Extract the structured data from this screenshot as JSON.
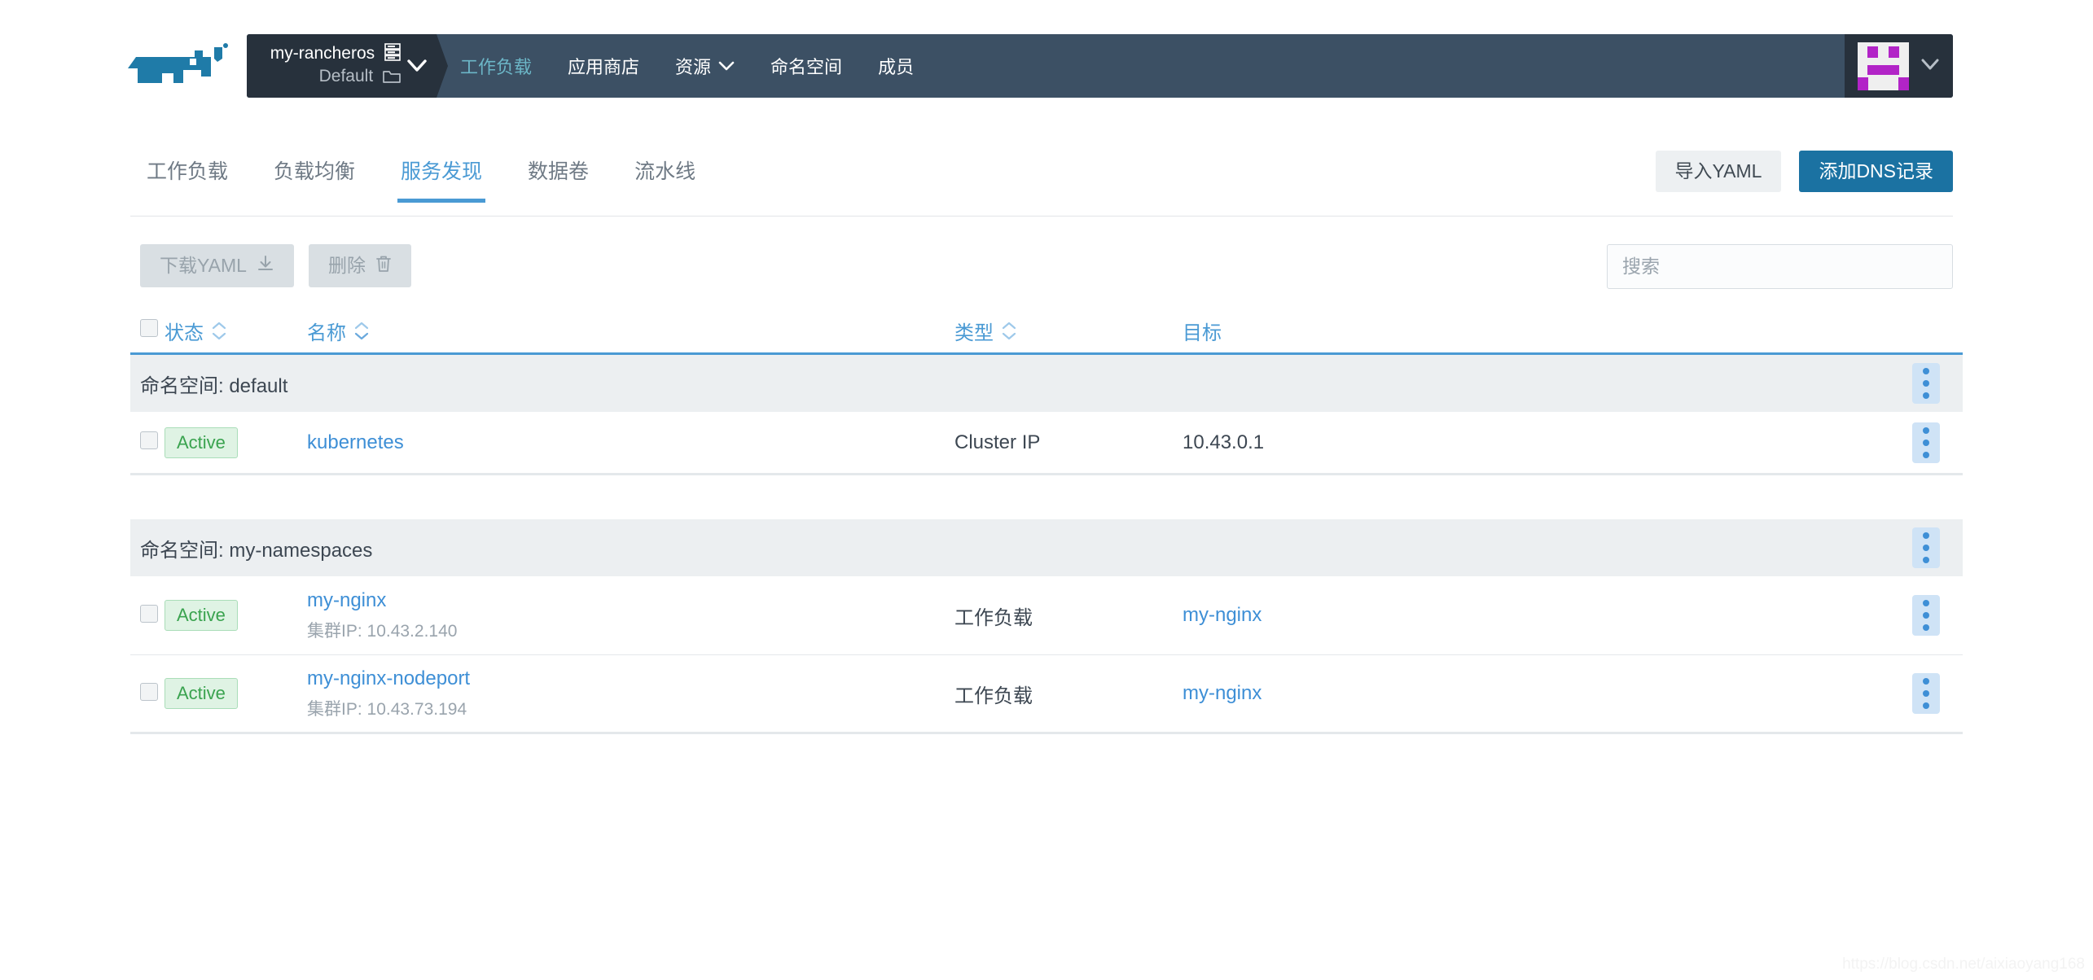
{
  "header": {
    "logo_name": "rancher-logo",
    "cluster": {
      "cluster_name": "my-rancheros",
      "project_name": "Default"
    },
    "nav": [
      {
        "label": "工作负载",
        "active": true,
        "has_chevron": false
      },
      {
        "label": "应用商店",
        "active": false,
        "has_chevron": false
      },
      {
        "label": "资源",
        "active": false,
        "has_chevron": true
      },
      {
        "label": "命名空间",
        "active": false,
        "has_chevron": false
      },
      {
        "label": "成员",
        "active": false,
        "has_chevron": false
      }
    ]
  },
  "tabs": [
    {
      "label": "工作负载",
      "active": false
    },
    {
      "label": "负载均衡",
      "active": false
    },
    {
      "label": "服务发现",
      "active": true
    },
    {
      "label": "数据卷",
      "active": false
    },
    {
      "label": "流水线",
      "active": false
    }
  ],
  "header_actions": {
    "import_yaml": "导入YAML",
    "add_dns": "添加DNS记录"
  },
  "toolbar": {
    "download_yaml": "下载YAML",
    "delete": "删除"
  },
  "search": {
    "value": "",
    "placeholder": "搜索"
  },
  "table": {
    "columns": {
      "state": "状态",
      "name": "名称",
      "type": "类型",
      "target": "目标"
    },
    "groups": [
      {
        "label": "命名空间: default",
        "rows": [
          {
            "state": "Active",
            "name": "kubernetes",
            "subtitle": "",
            "type": "Cluster IP",
            "target": "10.43.0.1",
            "target_is_link": false
          }
        ]
      },
      {
        "label": "命名空间: my-namespaces",
        "rows": [
          {
            "state": "Active",
            "name": "my-nginx",
            "subtitle": "集群IP: 10.43.2.140",
            "type": "工作负载",
            "target": "my-nginx",
            "target_is_link": true
          },
          {
            "state": "Active",
            "name": "my-nginx-nodeport",
            "subtitle": "集群IP: 10.43.73.194",
            "type": "工作负载",
            "target": "my-nginx",
            "target_is_link": true
          }
        ]
      }
    ]
  },
  "watermark": "https://blog.csdn.net/aixiaoyang168",
  "colors": {
    "navbar": "#3c5064",
    "navbar_dark": "#27313c",
    "nav_active": "#6cb6c7",
    "accent_blue": "#4a9ad4",
    "primary_button": "#1b72a2",
    "link": "#3e8fd6",
    "badge_text": "#3aa34f",
    "badge_bg": "#dff3e4",
    "group_bg": "#eceff1",
    "avatar": "#b224c7"
  }
}
